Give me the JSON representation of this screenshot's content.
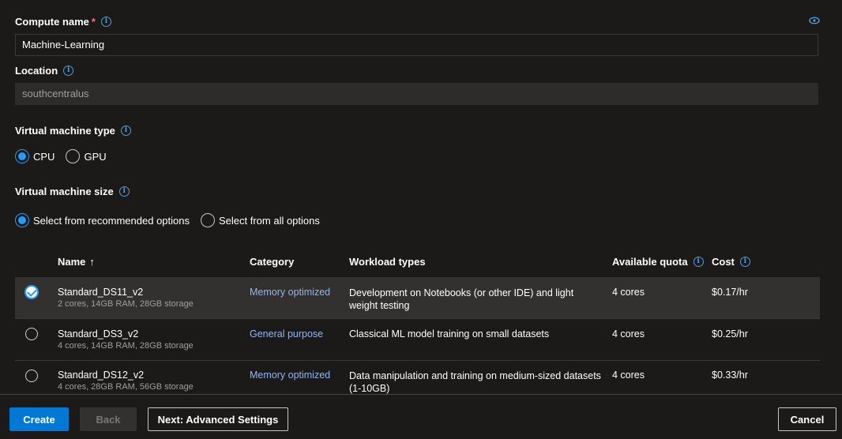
{
  "form": {
    "compute_name": {
      "label": "Compute name",
      "required": "*",
      "value": "Machine-Learning"
    },
    "location": {
      "label": "Location",
      "value": "southcentralus"
    },
    "vm_type": {
      "label": "Virtual machine type",
      "options": [
        "CPU",
        "GPU"
      ],
      "selected": "CPU"
    },
    "vm_size": {
      "label": "Virtual machine size",
      "options": [
        "Select from recommended options",
        "Select from all options"
      ],
      "selected": "Select from recommended options"
    }
  },
  "table": {
    "headers": {
      "name": "Name",
      "sort": "↑",
      "category": "Category",
      "workload": "Workload types",
      "quota": "Available quota",
      "cost": "Cost"
    },
    "rows": [
      {
        "name": "Standard_DS11_v2",
        "specs": "2 cores, 14GB RAM, 28GB storage",
        "category": "Memory optimized",
        "workload": "Development on Notebooks (or other IDE) and light weight testing",
        "quota": "4 cores",
        "cost": "$0.17/hr",
        "selected": true
      },
      {
        "name": "Standard_DS3_v2",
        "specs": "4 cores, 14GB RAM, 28GB storage",
        "category": "General purpose",
        "workload": "Classical ML model training on small datasets",
        "quota": "4 cores",
        "cost": "$0.25/hr",
        "selected": false
      },
      {
        "name": "Standard_DS12_v2",
        "specs": "4 cores, 28GB RAM, 56GB storage",
        "category": "Memory optimized",
        "workload": "Data manipulation and training on medium-sized datasets (1-10GB)",
        "quota": "4 cores",
        "cost": "$0.33/hr",
        "selected": false
      }
    ]
  },
  "footer": {
    "create": "Create",
    "back": "Back",
    "next": "Next: Advanced Settings",
    "cancel": "Cancel"
  },
  "icons": {
    "preview": "eye-icon",
    "info": "info-icon"
  },
  "colors": {
    "accent": "#0078d4",
    "radio": "#2899f5",
    "link": "#92b6f0",
    "background": "#1b1a19"
  }
}
